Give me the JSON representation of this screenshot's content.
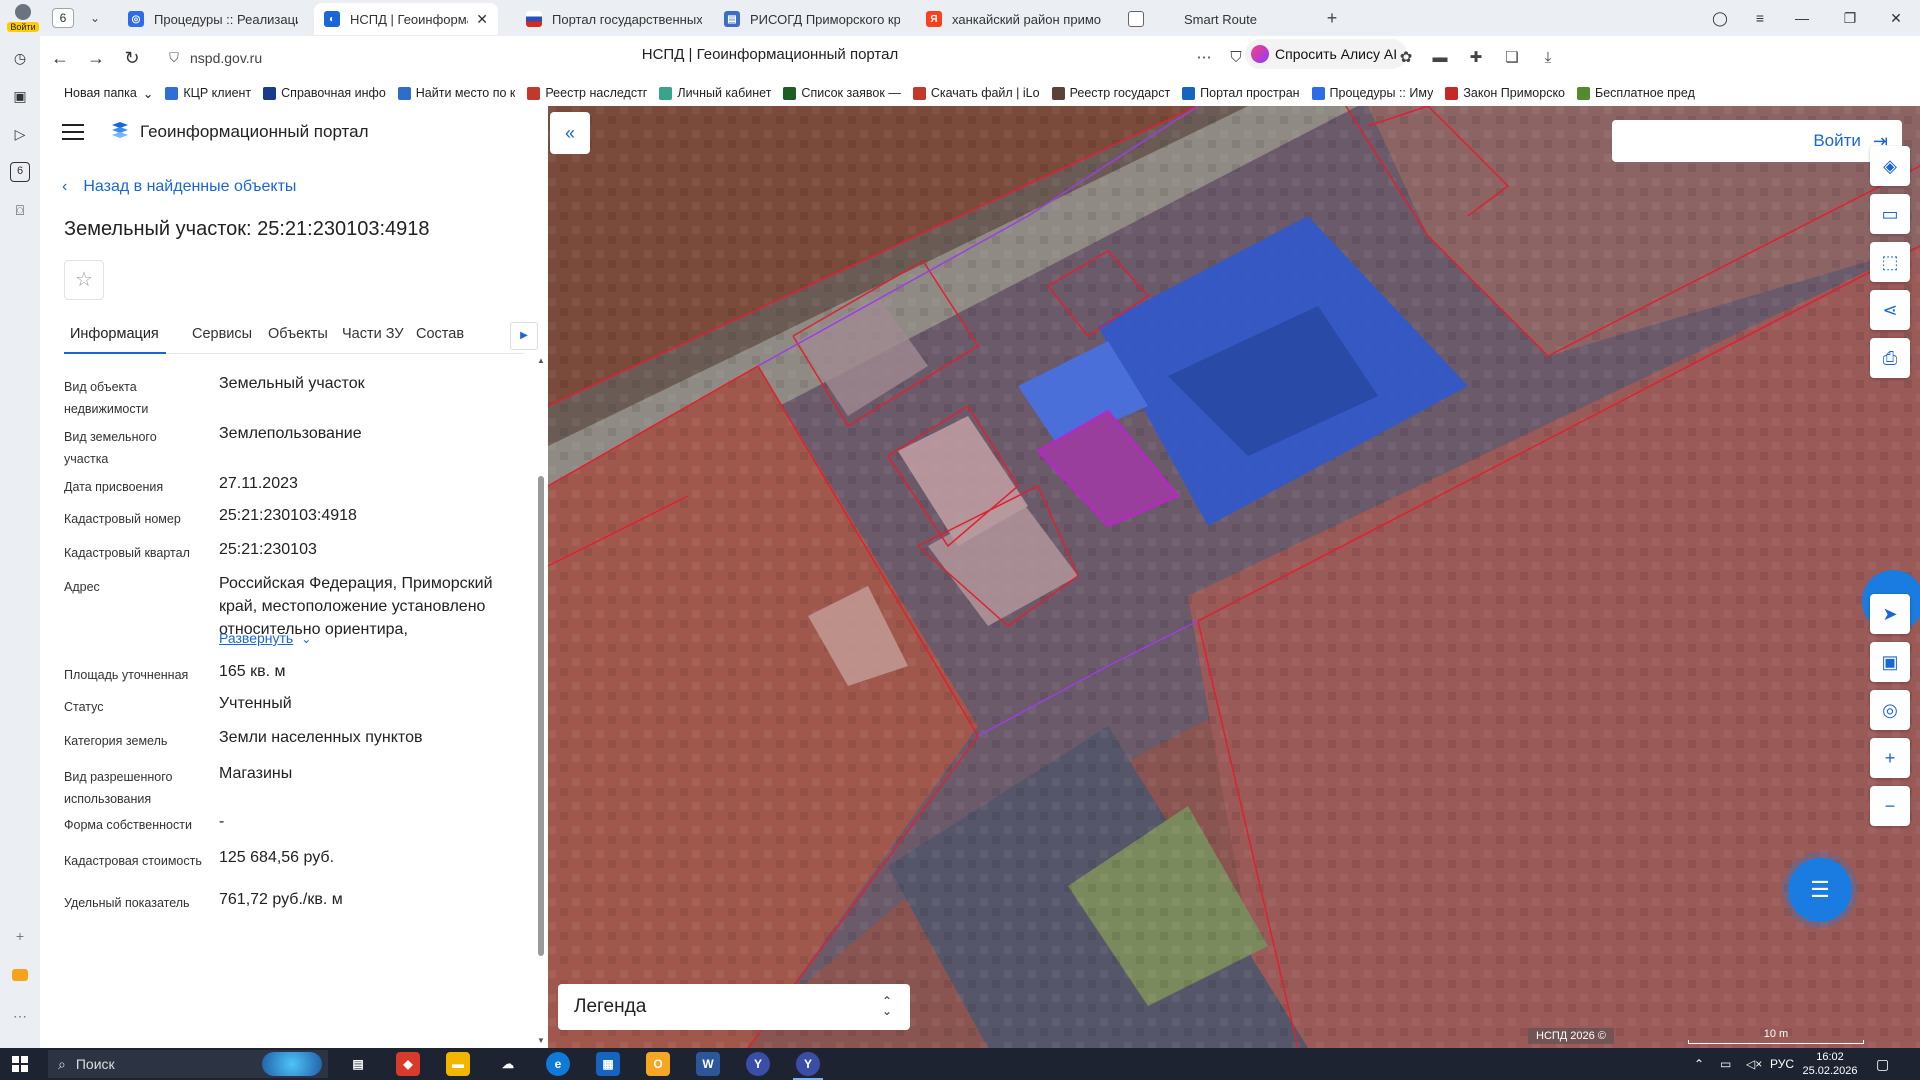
{
  "browser": {
    "profile_login": "Войти",
    "tab_count": "6",
    "tabs": [
      {
        "label": "Процедуры :: Реализация",
        "color": "#2e6be6",
        "glyph": "◎"
      },
      {
        "label": "НСПД | Геоинформаци",
        "color": "#1a66d6",
        "glyph": "◐",
        "active": true
      },
      {
        "label": "Портал государственных",
        "color": "#d52b1e",
        "glyph": "▬"
      },
      {
        "label": "РИСОГД Приморского кр",
        "color": "#3b6fc4",
        "glyph": "▤"
      },
      {
        "label": "ханкайский район примо",
        "color": "#fc3f1d",
        "glyph": "Я"
      },
      {
        "label": "Smart Route",
        "color": "#888888",
        "glyph": "▯"
      }
    ],
    "url": "nspd.gov.ru",
    "page_title": "НСПД | Геоинформационный портал",
    "alice_label": "Спросить Алису AI"
  },
  "bookmarks": [
    {
      "label": "Новая папка",
      "color": "transparent",
      "has_caret": true
    },
    {
      "label": "КЦР клиент",
      "color": "#2f6fd6"
    },
    {
      "label": "Справочная инфо",
      "color": "#1a3a8a"
    },
    {
      "label": "Найти место по к",
      "color": "#2d6fc8"
    },
    {
      "label": "Реестр наследстг",
      "color": "#c0392b"
    },
    {
      "label": "Личный кабинет",
      "color": "#3aa38b"
    },
    {
      "label": "Список заявок —",
      "color": "#1b5e20"
    },
    {
      "label": "Скачать файл | iLo",
      "color": "#c0392b"
    },
    {
      "label": "Реестр государст",
      "color": "#5d4037"
    },
    {
      "label": "Портал простран",
      "color": "#1565c0"
    },
    {
      "label": "Процедуры :: Иму",
      "color": "#2e6be6"
    },
    {
      "label": "Закон Приморско",
      "color": "#c62828"
    },
    {
      "label": "Бесплатное пред",
      "color": "#558b2f"
    }
  ],
  "panel": {
    "portal_name": "Геоинформационный портал",
    "back_label": "Назад в найденные объекты",
    "title": "Земельный участок: 25:21:230103:4918",
    "tabs": [
      "Информация",
      "Сервисы",
      "Объекты",
      "Части ЗУ",
      "Состав"
    ],
    "expand_label": "Развернуть",
    "attributes": [
      {
        "label": "Вид объекта недвижимости",
        "value": "Земельный участок"
      },
      {
        "label": "Вид земельного участка",
        "value": "Землепользование"
      },
      {
        "label": "Дата присвоения",
        "value": "27.11.2023"
      },
      {
        "label": "Кадастровый номер",
        "value": "25:21:230103:4918"
      },
      {
        "label": "Кадастровый квартал",
        "value": "25:21:230103"
      },
      {
        "label": "Адрес",
        "value": "Российская Федерация, Приморский край, местоположение установлено относительно ориентира,"
      },
      {
        "label": "Площадь уточненная",
        "value": "165 кв. м"
      },
      {
        "label": "Статус",
        "value": "Учтенный"
      },
      {
        "label": "Категория земель",
        "value": "Земли населенных пунктов"
      },
      {
        "label": "Вид разрешенного использования",
        "value": "Магазины"
      },
      {
        "label": "Форма собственности",
        "value": "-"
      },
      {
        "label": "Кадастровая стоимость",
        "value": "125 684,56 руб."
      },
      {
        "label": "Удельный показатель",
        "value": "761,72 руб./кв. м"
      }
    ]
  },
  "map": {
    "login_label": "Войти",
    "legend_label": "Легенда",
    "attribution": "НСПД 2026 ©",
    "scale_label": "10 m",
    "tools": [
      "layers-icon",
      "ruler-icon",
      "select-area-icon",
      "share-icon",
      "print-icon"
    ],
    "nav_tools": [
      "locate-icon",
      "minimap-icon",
      "search-location-icon"
    ],
    "colors": {
      "parcel_border": "#e02030",
      "selected_fill": "#2f5be8",
      "highlight": "#c020d0",
      "accent": "#1a66d6"
    }
  },
  "taskbar": {
    "search_placeholder": "Поиск",
    "language": "РУС",
    "time": "16:02",
    "date": "25.02.2026"
  }
}
